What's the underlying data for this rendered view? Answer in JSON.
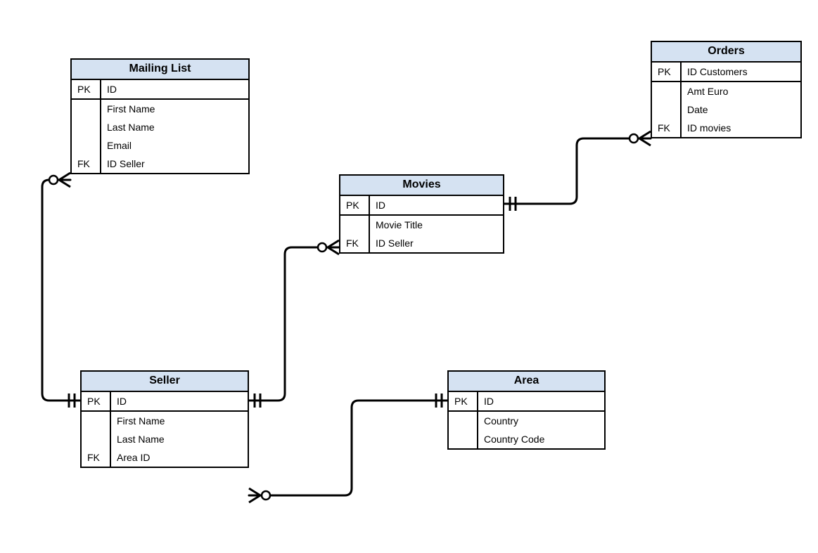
{
  "entities": {
    "mailing_list": {
      "title": "Mailing List",
      "pk_label": "PK",
      "pk_attr": "ID",
      "rows": [
        {
          "key": "",
          "attr": "First Name"
        },
        {
          "key": "",
          "attr": "Last Name"
        },
        {
          "key": "",
          "attr": "Email"
        },
        {
          "key": "FK",
          "attr": "ID Seller"
        }
      ]
    },
    "orders": {
      "title": "Orders",
      "pk_label": "PK",
      "pk_attr": "ID Customers",
      "rows": [
        {
          "key": "",
          "attr": "Amt Euro"
        },
        {
          "key": "",
          "attr": "Date"
        },
        {
          "key": "FK",
          "attr": "ID movies"
        }
      ]
    },
    "movies": {
      "title": "Movies",
      "pk_label": "PK",
      "pk_attr": "ID",
      "rows": [
        {
          "key": "",
          "attr": "Movie  Title"
        },
        {
          "key": "FK",
          "attr": "ID Seller"
        }
      ]
    },
    "seller": {
      "title": "Seller",
      "pk_label": "PK",
      "pk_attr": "ID",
      "rows": [
        {
          "key": "",
          "attr": "First Name"
        },
        {
          "key": "",
          "attr": "Last Name"
        },
        {
          "key": "FK",
          "attr": "Area ID"
        }
      ]
    },
    "area": {
      "title": "Area",
      "pk_label": "PK",
      "pk_attr": "ID",
      "rows": [
        {
          "key": "",
          "attr": "Country"
        },
        {
          "key": "",
          "attr": "Country Code"
        }
      ]
    }
  },
  "relationships": [
    {
      "from": "seller",
      "to": "mailing_list",
      "type": "one-to-many-optional"
    },
    {
      "from": "seller",
      "to": "movies",
      "type": "one-to-many-optional"
    },
    {
      "from": "movies",
      "to": "orders",
      "type": "one-to-many-optional"
    },
    {
      "from": "area",
      "to": "seller",
      "type": "one-to-many-optional"
    }
  ]
}
